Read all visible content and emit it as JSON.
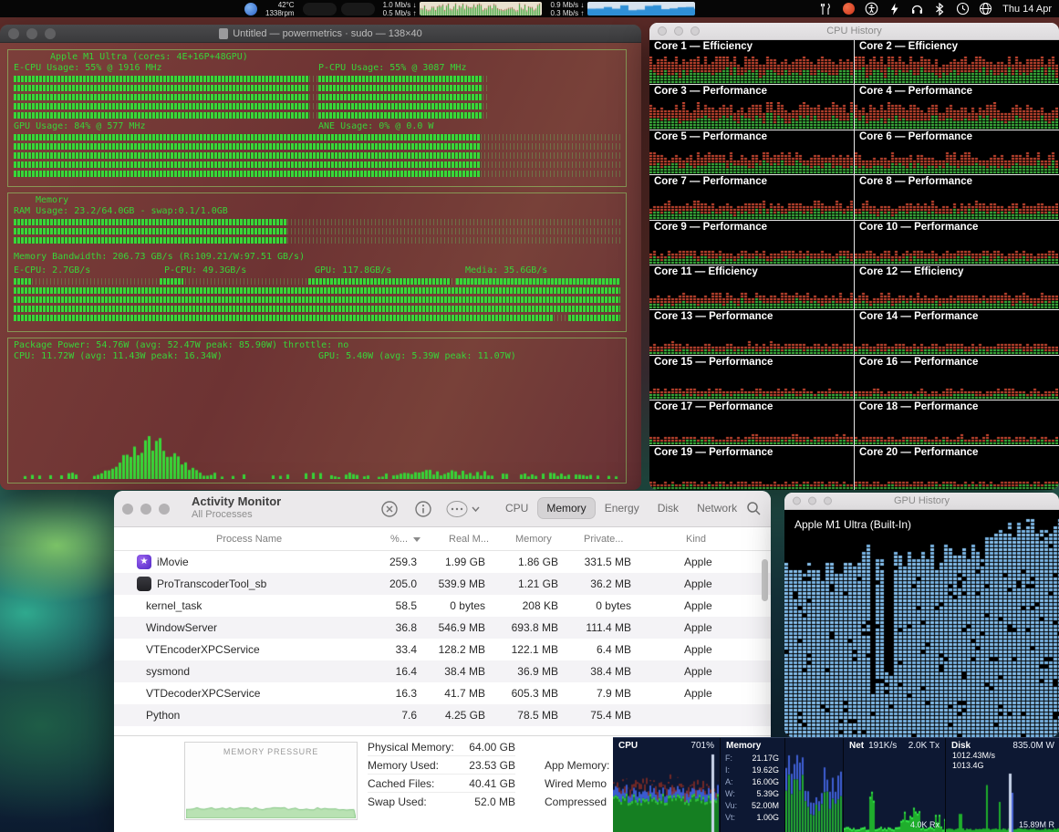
{
  "menu_bar": {
    "temp": "42°C",
    "fan": "1338rpm",
    "net1": {
      "down": "1.0 Mb/s ↓",
      "up": "0.5 Mb/s ↑"
    },
    "net2": {
      "down": "0.9 Mb/s ↓",
      "up": "0.3 Mb/s ↑"
    },
    "date": "Thu 14 Apr"
  },
  "terminal": {
    "title": "Untitled — powermetrics · sudo — 138×40",
    "cpu_box": {
      "header": "Apple M1 Ultra (cores: 4E+16P+48GPU)",
      "ecpu_label": "E-CPU Usage: 55% @ 1916 MHz",
      "pcpu_label": "P-CPU Usage: 55% @ 3087 MHz",
      "gpu_label": "GPU Usage: 84% @ 577 MHz",
      "ane_label": "ANE Usage: 0% @ 0.0 W"
    },
    "memory_box": {
      "title": "Memory",
      "ram_label": "RAM Usage: 23.2/64.0GB - swap:0.1/1.0GB",
      "bandwidth_label": "Memory Bandwidth: 206.73 GB/s (R:109.21/W:97.51 GB/s)",
      "channels": [
        "E-CPU: 2.7GB/s",
        "P-CPU: 49.3GB/s",
        "GPU: 117.8GB/s",
        "Media: 35.6GB/s"
      ]
    },
    "power_box": {
      "package_label": "Package Power: 54.76W (avg: 52.47W peak: 85.90W) throttle: no",
      "cpu_label": "CPU: 11.72W (avg: 11.43W peak: 16.34W)",
      "gpu_label": "GPU: 5.40W (avg: 5.39W peak: 11.07W)"
    },
    "bars": {
      "ecpu": {
        "rows": 5,
        "fill": 97
      },
      "pcpu": {
        "rows": 5,
        "fill": 97
      },
      "gpu": {
        "rows": 5,
        "fill": 77
      },
      "ram": {
        "rows": 3,
        "fill": 45
      },
      "bw_segments": [
        [
          0,
          3
        ],
        [
          24,
          4
        ],
        [
          48.5,
          23.5
        ],
        [
          73,
          27
        ]
      ],
      "bw": {
        "rows": 3,
        "fill": 100
      },
      "bw_last_segments": [
        [
          0,
          89
        ],
        [
          91.5,
          8.5
        ]
      ]
    }
  },
  "cpu_history": {
    "title": "CPU History",
    "cores": [
      "Core 1 — Efficiency",
      "Core 2 — Efficiency",
      "Core 3 — Performance",
      "Core 4 — Performance",
      "Core 5 — Performance",
      "Core 6 — Performance",
      "Core 7 — Performance",
      "Core 8 — Performance",
      "Core 9 — Performance",
      "Core 10 — Performance",
      "Core 11 — Efficiency",
      "Core 12 — Efficiency",
      "Core 13 — Performance",
      "Core 14 — Performance",
      "Core 15 — Performance",
      "Core 16 — Performance",
      "Core 17 — Performance",
      "Core 18 — Performance",
      "Core 19 — Performance",
      "Core 20 — Performance"
    ],
    "levels": [
      0.96,
      0.96,
      0.9,
      0.88,
      0.72,
      0.7,
      0.62,
      0.6,
      0.5,
      0.48,
      0.54,
      0.52,
      0.42,
      0.4,
      0.37,
      0.35,
      0.33,
      0.32,
      0.3,
      0.3
    ]
  },
  "activity_monitor": {
    "title": "Activity Monitor",
    "subtitle": "All Processes",
    "tabs": [
      {
        "label": "CPU",
        "selected": false
      },
      {
        "label": "Memory",
        "selected": true
      },
      {
        "label": "Energy",
        "selected": false
      },
      {
        "label": "Disk",
        "selected": false
      },
      {
        "label": "Network",
        "selected": false
      }
    ],
    "columns": [
      "Process Name",
      "%...",
      "Real M...",
      "Memory",
      "Private...",
      "Kind"
    ],
    "rows": [
      {
        "name": "iMovie",
        "icon": "imovie",
        "cpu": "259.3",
        "real": "1.99 GB",
        "memory": "1.86 GB",
        "private": "331.5 MB",
        "kind": "Apple"
      },
      {
        "name": "ProTranscoderTool_sb",
        "icon": "protool",
        "cpu": "205.0",
        "real": "539.9 MB",
        "memory": "1.21 GB",
        "private": "36.2 MB",
        "kind": "Apple"
      },
      {
        "name": "kernel_task",
        "icon": "",
        "cpu": "58.5",
        "real": "0 bytes",
        "memory": "208 KB",
        "private": "0 bytes",
        "kind": "Apple"
      },
      {
        "name": "WindowServer",
        "icon": "",
        "cpu": "36.8",
        "real": "546.9 MB",
        "memory": "693.8 MB",
        "private": "111.4 MB",
        "kind": "Apple"
      },
      {
        "name": "VTEncoderXPCService",
        "icon": "",
        "cpu": "33.4",
        "real": "128.2 MB",
        "memory": "122.1 MB",
        "private": "6.4 MB",
        "kind": "Apple"
      },
      {
        "name": "sysmond",
        "icon": "",
        "cpu": "16.4",
        "real": "38.4 MB",
        "memory": "36.9 MB",
        "private": "38.4 MB",
        "kind": "Apple"
      },
      {
        "name": "VTDecoderXPCService",
        "icon": "",
        "cpu": "16.3",
        "real": "41.7 MB",
        "memory": "605.3 MB",
        "private": "7.9 MB",
        "kind": "Apple"
      },
      {
        "name": "Python",
        "icon": "",
        "cpu": "7.6",
        "real": "4.25 GB",
        "memory": "78.5 MB",
        "private": "75.4 MB",
        "kind": ""
      }
    ],
    "footer": {
      "pressure_label": "MEMORY PRESSURE",
      "stats": [
        {
          "label": "Physical Memory:",
          "value": "64.00 GB"
        },
        {
          "label": "Memory Used:",
          "value": "23.53 GB"
        },
        {
          "label": "Cached Files:",
          "value": "40.41 GB"
        },
        {
          "label": "Swap Used:",
          "value": "52.0 MB"
        }
      ],
      "right_stats": [
        "App Memory:",
        "Wired Memo",
        "Compressed"
      ]
    }
  },
  "gpu_history": {
    "title": "GPU History",
    "gpu_label": "Apple M1 Ultra (Built-In)"
  },
  "istat": {
    "cpu": {
      "label": "CPU",
      "value": "701%"
    },
    "memory": {
      "label": "Memory",
      "lines": [
        [
          "F:",
          "21.17G"
        ],
        [
          "I:",
          "19.62G"
        ],
        [
          "A:",
          "16.00G"
        ],
        [
          "W:",
          "5.39G"
        ],
        [
          "Vu:",
          "52.00M"
        ],
        [
          "Vt:",
          "1.00G"
        ]
      ]
    },
    "net": {
      "label": "Net",
      "value": "191K/s",
      "tx": "2.0K Tx",
      "rx": "4.0K Rx"
    },
    "disk": {
      "label": "Disk",
      "value1": "1012.43M/s",
      "value2": "1013.4G",
      "w": "835.0M W",
      "r": "15.89M R"
    }
  }
}
